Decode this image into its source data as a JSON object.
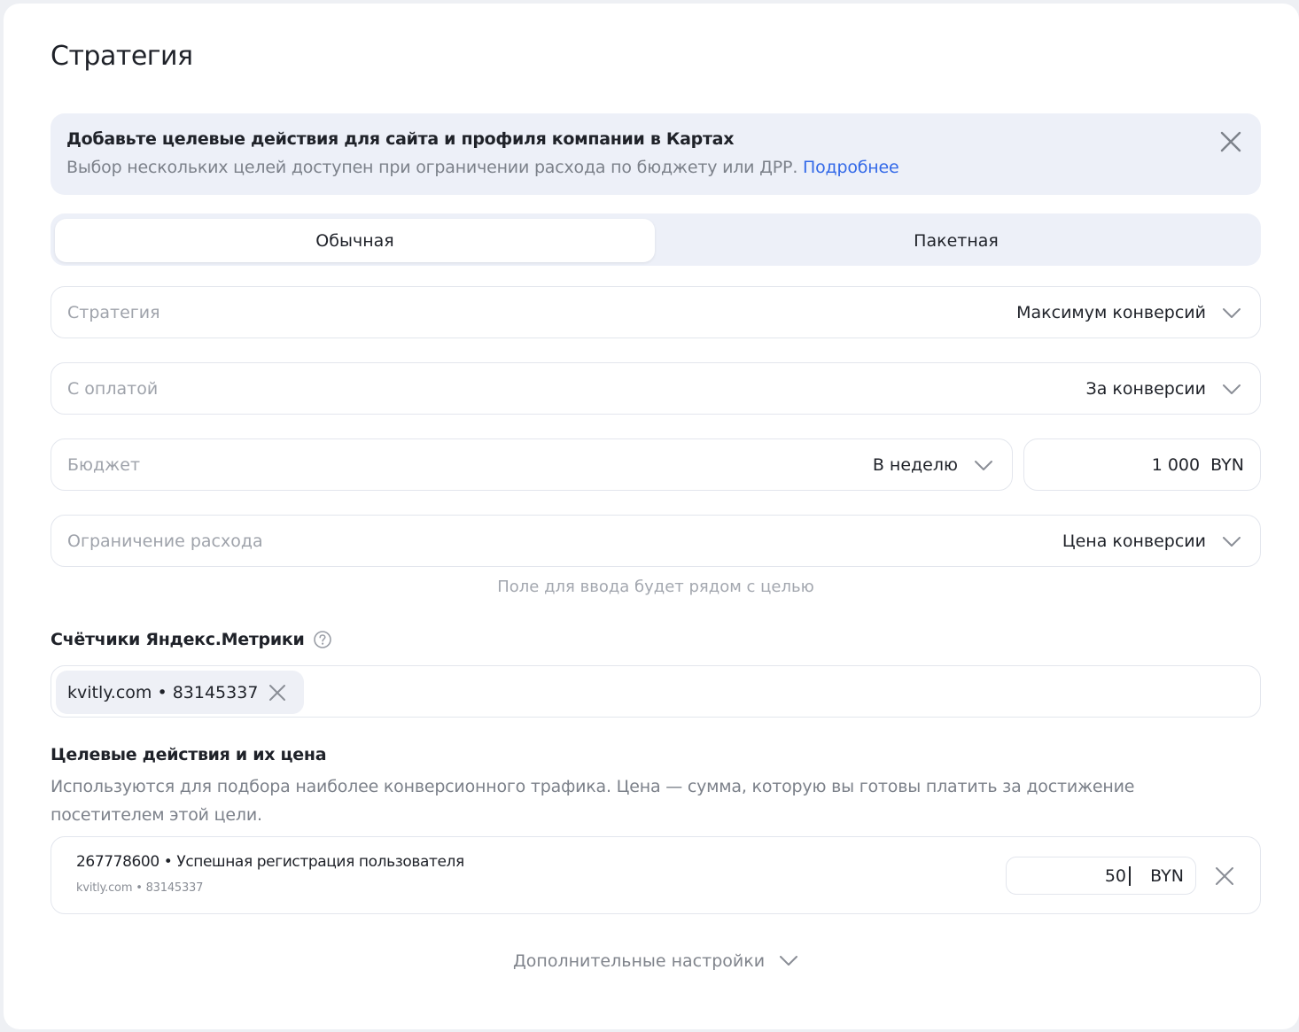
{
  "page": {
    "title": "Стратегия"
  },
  "banner": {
    "title": "Добавьте целевые действия для сайта и профиля компании в Картах",
    "text": "Выбор нескольких целей доступен при ограничении расхода по бюджету или ДРР.",
    "link": "Подробнее",
    "close_icon": "close-icon"
  },
  "tabs": [
    {
      "label": "Обычная",
      "active": true
    },
    {
      "label": "Пакетная",
      "active": false
    }
  ],
  "fields": {
    "strategy": {
      "label": "Стратегия",
      "value": "Максимум конверсий"
    },
    "payment": {
      "label": "С оплатой",
      "value": "За конверсии"
    },
    "budget": {
      "label": "Бюджет",
      "period": "В неделю",
      "amount": "1 000  BYN"
    },
    "limit": {
      "label": "Ограничение расхода",
      "value": "Цена конверсии"
    },
    "limit_hint": "Поле для ввода будет рядом с целью"
  },
  "metrika": {
    "label": "Счётчики Яндекс.Метрики",
    "help_icon": "help-circle-icon",
    "chips": [
      {
        "text": "kvitly.com • 83145337"
      }
    ]
  },
  "goals": {
    "label": "Целевые действия и их цена",
    "description": "Используются для подбора наиболее конверсионного трафика. Цена — сумма, которую вы готовы платить за достижение посетителем этой цели.",
    "items": [
      {
        "title": "267778600 • Успешная регистрация пользователя",
        "subtitle": "kvitly.com • 83145337",
        "price": "50",
        "currency": "BYN"
      }
    ]
  },
  "more_settings": "Дополнительные настройки",
  "colors": {
    "accent_link": "#3369e8",
    "banner_bg": "#edf0f8",
    "border": "#e3e6ed"
  }
}
